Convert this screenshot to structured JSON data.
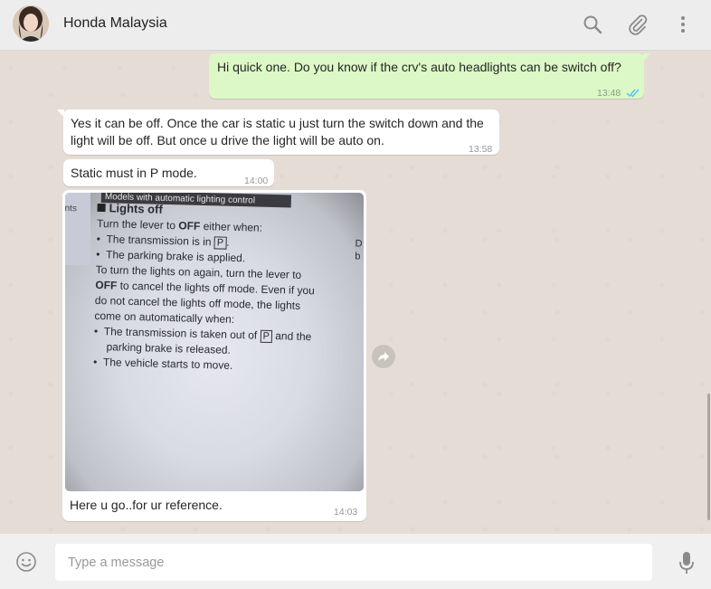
{
  "header": {
    "contact_name": "Honda Malaysia",
    "icons": [
      "avatar",
      "search-icon",
      "attach-icon",
      "menu-icon"
    ]
  },
  "messages": [
    {
      "direction": "outgoing",
      "text": "Hi        quick one. Do you know if the crv's auto headlights can be switch off?",
      "time": "13:48",
      "status": "read"
    },
    {
      "direction": "incoming",
      "text": "Yes it can be off. Once the car is static u just turn the switch down and the light will be off. But once u drive the light will be auto on.",
      "time": "13:58"
    },
    {
      "direction": "incoming",
      "text": "Static must in P mode.",
      "time": "14:00"
    },
    {
      "direction": "incoming",
      "type": "image",
      "caption": "Here u go..for ur reference.",
      "time": "14:03",
      "image_text": {
        "strip": "Models with automatic lighting control",
        "side": "nts",
        "heading": "Lights off",
        "l1a": "Turn the lever to ",
        "l1b": "OFF",
        "l1c": " either when:",
        "l2a": "The transmission is in ",
        "l2b": "P",
        "l2c": ".",
        "l3": "The parking brake is applied.",
        "l4": "To turn the lights on again, turn the lever to",
        "l5a": "OFF",
        "l5b": " to cancel the lights off mode. Even if you",
        "l6": "do not cancel the lights off mode, the lights",
        "l7": "come on automatically when:",
        "l8a": "The transmission is taken out of ",
        "l8b": "P",
        "l8c": " and the",
        "l9": "parking brake is released.",
        "l10": "The vehicle starts to move.",
        "edge1": "D",
        "edge2": "b"
      }
    }
  ],
  "composer": {
    "placeholder": "Type a message"
  },
  "colors": {
    "outgoing_bubble": "#dcf8c6",
    "incoming_bubble": "#ffffff",
    "read_ticks": "#4fc3f7",
    "chat_bg": "#e5ddd5"
  }
}
